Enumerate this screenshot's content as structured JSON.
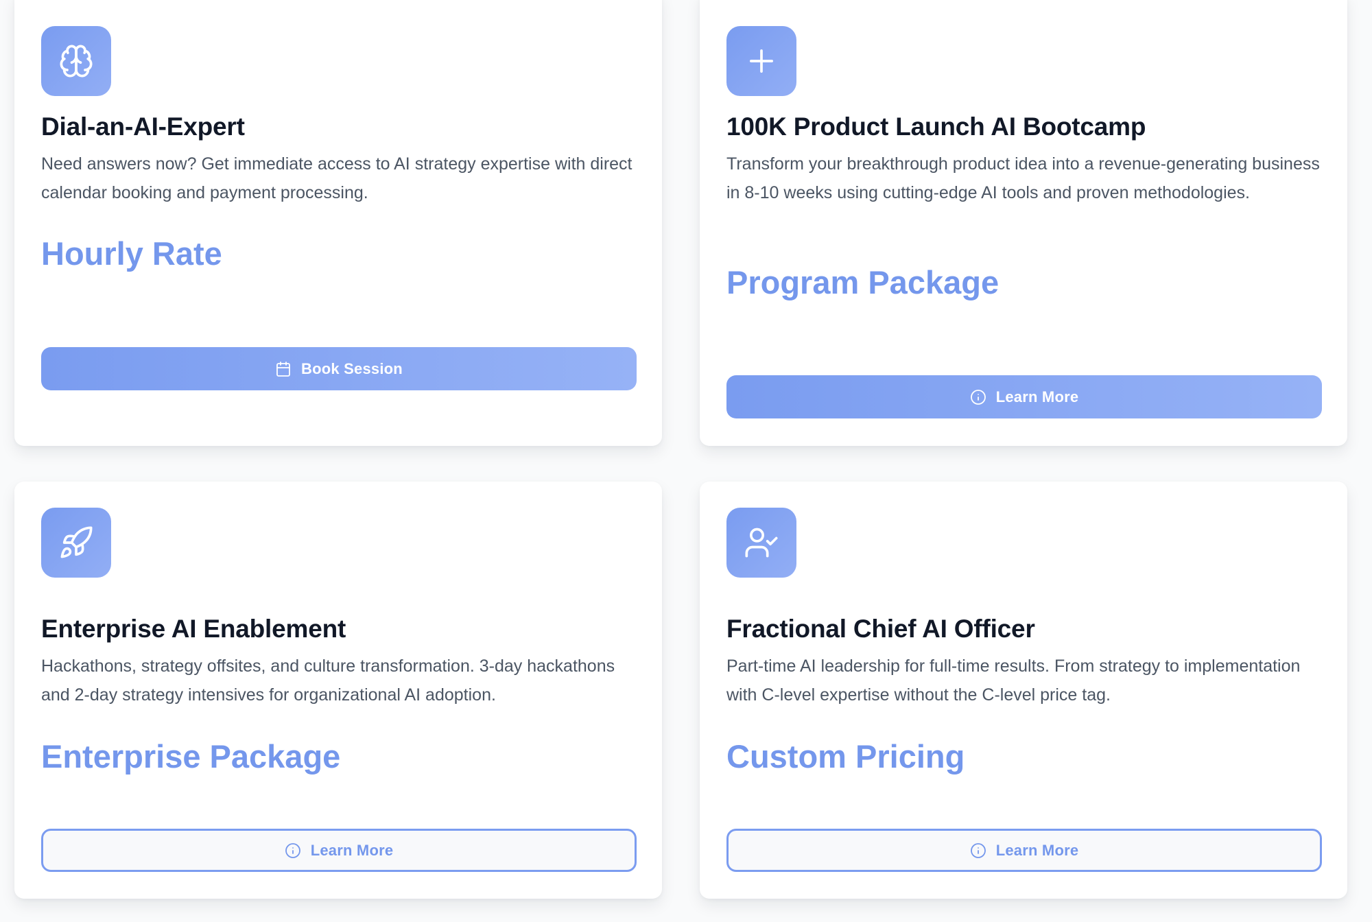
{
  "colors": {
    "accent": "#7497ec",
    "icon_tile": "#7a9cf0",
    "title": "#111827",
    "description": "#4b5563",
    "card_background": "#ffffff"
  },
  "cards": [
    {
      "icon": "brain-icon",
      "title": "Dial-an-AI-Expert",
      "description": "Need answers now? Get immediate access to AI strategy expertise with direct calendar booking and payment processing.",
      "price": "Hourly Rate",
      "button": {
        "label": "Book Session",
        "icon": "calendar-icon",
        "style": "solid"
      }
    },
    {
      "icon": "plus-icon",
      "title": "100K Product Launch AI Bootcamp",
      "description": "Transform your breakthrough product idea into a revenue-generating business in 8-10 weeks using cutting-edge AI tools and proven methodologies.",
      "price": "Program Package",
      "button": {
        "label": "Learn More",
        "icon": "info-icon",
        "style": "solid"
      }
    },
    {
      "icon": "rocket-icon",
      "title": "Enterprise AI Enablement",
      "description": "Hackathons, strategy offsites, and culture transformation. 3-day hackathons and 2-day strategy intensives for organizational AI adoption.",
      "price": "Enterprise Package",
      "button": {
        "label": "Learn More",
        "icon": "info-icon",
        "style": "outline"
      }
    },
    {
      "icon": "user-check-icon",
      "title": "Fractional Chief AI Officer",
      "description": "Part-time AI leadership for full-time results. From strategy to implementation with C-level expertise without the C-level price tag.",
      "price": "Custom Pricing",
      "button": {
        "label": "Learn More",
        "icon": "info-icon",
        "style": "outline"
      }
    }
  ]
}
